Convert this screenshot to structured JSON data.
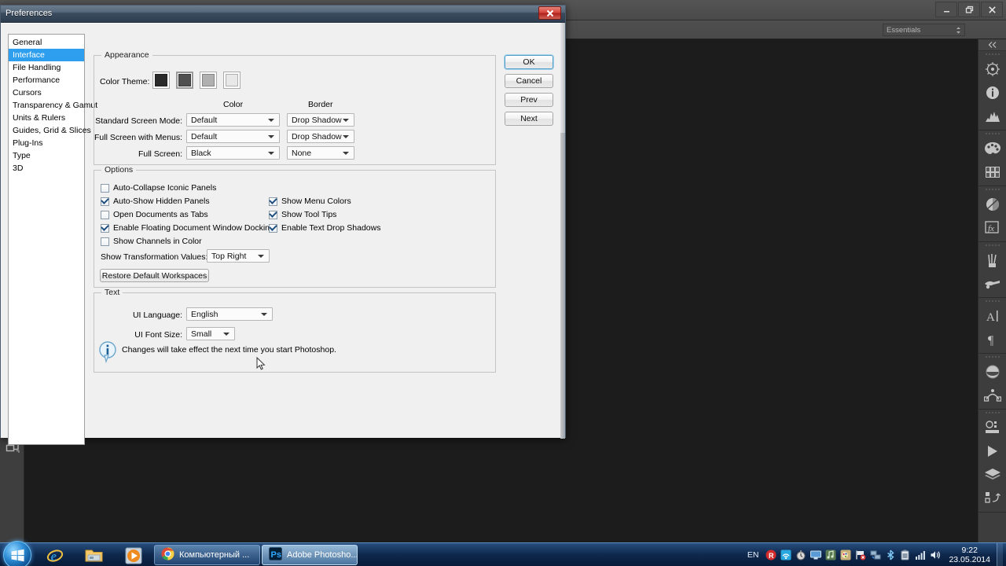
{
  "photoshop": {
    "window_buttons": [
      "minimize",
      "restore",
      "close"
    ],
    "workspace_selector": "Essentials",
    "dock_groups": [
      {
        "icons": [
          "adjustments-icon",
          "info-icon",
          "histogram-icon"
        ]
      },
      {
        "icons": [
          "color-icon",
          "swatches-icon"
        ]
      },
      {
        "icons": [
          "styles-icon",
          "fx-icon"
        ]
      },
      {
        "icons": [
          "brush-icon",
          "brush-presets-icon"
        ]
      },
      {
        "icons": [
          "character-icon",
          "paragraph-icon"
        ]
      },
      {
        "icons": [
          "3d-icon",
          "paths-icon"
        ]
      },
      {
        "icons": [
          "timeline-icon",
          "actions-icon",
          "layers-icon",
          "history-icon"
        ]
      }
    ],
    "tool_strip_icon": "arrange-documents-icon"
  },
  "dialog": {
    "title": "Preferences",
    "close_label": "✕",
    "sidebar": {
      "items": [
        {
          "label": "General",
          "selected": false
        },
        {
          "label": "Interface",
          "selected": true
        },
        {
          "label": "File Handling",
          "selected": false
        },
        {
          "label": "Performance",
          "selected": false
        },
        {
          "label": "Cursors",
          "selected": false
        },
        {
          "label": "Transparency & Gamut",
          "selected": false
        },
        {
          "label": "Units & Rulers",
          "selected": false
        },
        {
          "label": "Guides, Grid & Slices",
          "selected": false
        },
        {
          "label": "Plug-Ins",
          "selected": false
        },
        {
          "label": "Type",
          "selected": false
        },
        {
          "label": "3D",
          "selected": false
        }
      ]
    },
    "actions": [
      {
        "label": "OK",
        "default": true
      },
      {
        "label": "Cancel",
        "default": false
      },
      {
        "label": "Prev",
        "default": false
      },
      {
        "label": "Next",
        "default": false
      }
    ],
    "appearance": {
      "legend": "Appearance",
      "color_theme_label": "Color Theme:",
      "swatches": [
        {
          "color": "#2b2b2b",
          "selected": false
        },
        {
          "color": "#4f4f4f",
          "selected": true
        },
        {
          "color": "#b0b0b0",
          "selected": false
        },
        {
          "color": "#e8e8e8",
          "selected": false
        }
      ],
      "col_header_color": "Color",
      "col_header_border": "Border",
      "rows": [
        {
          "label": "Standard Screen Mode:",
          "color": "Default",
          "border": "Drop Shadow"
        },
        {
          "label": "Full Screen with Menus:",
          "color": "Default",
          "border": "Drop Shadow"
        },
        {
          "label": "Full Screen:",
          "color": "Black",
          "border": "None"
        }
      ]
    },
    "options": {
      "legend": "Options",
      "checks_left": [
        {
          "label": "Auto-Collapse Iconic Panels",
          "checked": false
        },
        {
          "label": "Auto-Show Hidden Panels",
          "checked": true
        },
        {
          "label": "Open Documents as Tabs",
          "checked": false
        },
        {
          "label": "Enable Floating Document Window Docking",
          "checked": true
        },
        {
          "label": "Show Channels in Color",
          "checked": false
        }
      ],
      "checks_right": [
        {
          "label": "Show Menu Colors",
          "checked": true
        },
        {
          "label": "Show Tool Tips",
          "checked": true
        },
        {
          "label": "Enable Text Drop Shadows",
          "checked": true
        }
      ],
      "transform_label": "Show Transformation Values:",
      "transform_value": "Top Right",
      "restore_button": "Restore Default Workspaces"
    },
    "text": {
      "legend": "Text",
      "ui_language_label": "UI Language:",
      "ui_language_value": "English",
      "ui_font_size_label": "UI Font Size:",
      "ui_font_size_value": "Small",
      "note": "Changes will take effect the next time you start Photoshop.",
      "note_icon": "info-icon"
    }
  },
  "taskbar": {
    "start_label": "start-orb",
    "quick_launch": [
      "internet-explorer-icon",
      "explorer-icon",
      "media-player-icon"
    ],
    "tasks": [
      {
        "label": "Компьютерный ...",
        "icon": "chrome-icon",
        "active": false
      },
      {
        "label": "Adobe Photosho...",
        "icon": "photoshop-icon",
        "active": true
      }
    ],
    "tray": {
      "language": "EN",
      "icons": [
        "r-icon",
        "wifi-icon",
        "clock-widget-icon",
        "display-icon",
        "audio-icon",
        "paint-icon",
        "flag-icon",
        "network-icon",
        "bluetooth-icon",
        "battery-icon",
        "signal-icon",
        "volume-icon"
      ],
      "time": "9:22",
      "date": "23.05.2014"
    }
  }
}
